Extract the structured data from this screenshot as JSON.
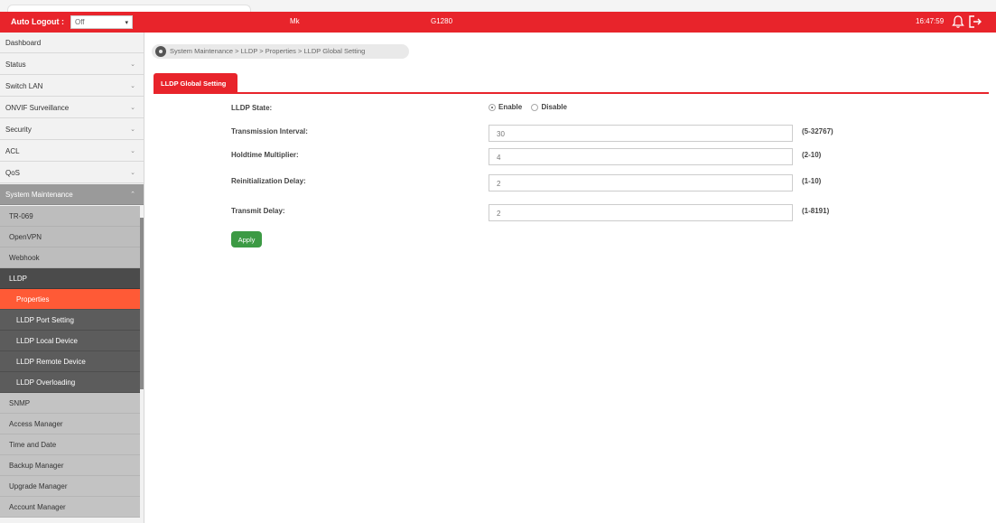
{
  "header": {
    "logout_label": "Auto Logout :",
    "logout_value": "Off",
    "model": "Mk",
    "device": "G1280",
    "clock": "16:47:59",
    "icons": [
      "bell-icon",
      "logout-icon"
    ]
  },
  "sidebar": {
    "items": [
      {
        "label": "Dashboard"
      },
      {
        "label": "Status"
      },
      {
        "label": "Switch LAN"
      },
      {
        "label": "ONVIF Surveillance"
      },
      {
        "label": "Security"
      },
      {
        "label": "ACL"
      },
      {
        "label": "QoS"
      },
      {
        "label": "System Maintenance"
      }
    ],
    "sub_items": [
      {
        "label": "TR-069"
      },
      {
        "label": "OpenVPN"
      },
      {
        "label": "Webhook"
      },
      {
        "label": "LLDP"
      }
    ],
    "lldp_items": [
      {
        "label": "Properties"
      },
      {
        "label": "LLDP Port Setting"
      },
      {
        "label": "LLDP Local Device"
      },
      {
        "label": "LLDP Remote Device"
      },
      {
        "label": "LLDP Overloading"
      }
    ],
    "lower_items": [
      {
        "label": "SNMP"
      },
      {
        "label": "Access Manager"
      },
      {
        "label": "Time and Date"
      },
      {
        "label": "Backup Manager"
      },
      {
        "label": "Upgrade Manager"
      },
      {
        "label": "Account Manager"
      }
    ]
  },
  "breadcrumb": "System Maintenance > LLDP > Properties  > LLDP Global Setting",
  "tab": "LLDP Global Setting",
  "form": {
    "state_label": "LLDP State:",
    "enable_label": "Enable",
    "disable_label": "Disable",
    "fields": [
      {
        "label": "Transmission Interval:",
        "value": "30",
        "range": "(5-32767)"
      },
      {
        "label": "Holdtime Multiplier:",
        "value": "4",
        "range": "(2-10)"
      },
      {
        "label": "Reinitialization Delay:",
        "value": "2",
        "range": "(1-10)"
      },
      {
        "label": "Transmit Delay:",
        "value": "2",
        "range": "(1-8191)"
      }
    ],
    "apply_label": "Apply"
  },
  "colors": {
    "accent": "#e8242b",
    "active_item": "#ff5a36",
    "apply_button": "#3c9a44"
  }
}
